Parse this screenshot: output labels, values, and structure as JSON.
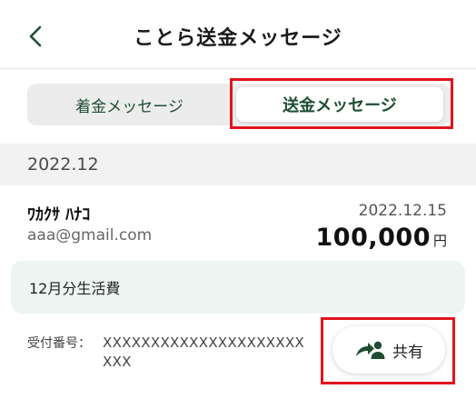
{
  "header": {
    "title": "ことら送金メッセージ",
    "back_icon": "chevron-left-icon"
  },
  "tabs": {
    "received_label": "着金メッセージ",
    "sent_label": "送金メッセージ",
    "active": "sent"
  },
  "month_section": {
    "label": "2022.12"
  },
  "transaction": {
    "name": "ﾜｶｸｻ ﾊﾅｺ",
    "email": "aaa@gmail.com",
    "date": "2022.12.15",
    "amount": "100,000",
    "currency": "円",
    "memo": "12月分生活費",
    "receipt_label": "受付番号：",
    "receipt_number": "XXXXXXXXXXXXXXXXXXXXXXXX",
    "share_label": "共有",
    "share_icon": "share-person-icon"
  },
  "colors": {
    "accent": "#1e4d33",
    "highlight_border": "#e0141e",
    "memo_bg": "#edf5f2",
    "band_bg": "#f2f2f2"
  }
}
